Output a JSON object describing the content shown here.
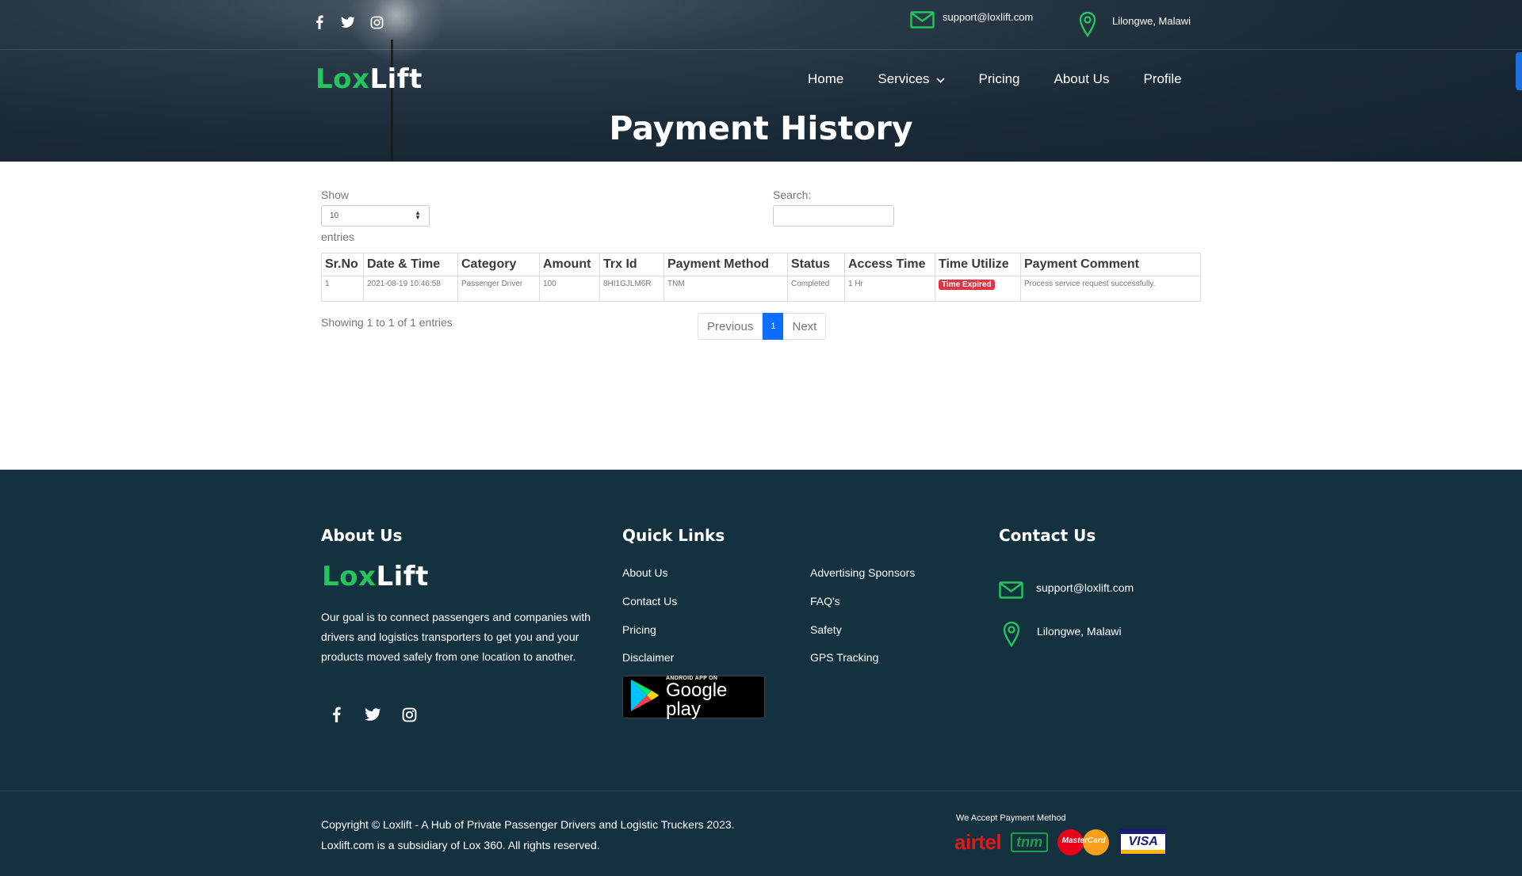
{
  "header": {
    "email": "support@loxlift.com",
    "location": "Lilongwe, Malawi",
    "logo": {
      "part1": "Lox",
      "part2": "Lift"
    },
    "nav": [
      {
        "label": "Home"
      },
      {
        "label": "Services",
        "dropdown": true
      },
      {
        "label": "Pricing"
      },
      {
        "label": "About Us"
      },
      {
        "label": "Profile"
      }
    ],
    "social_icons": [
      "facebook-icon",
      "twitter-icon",
      "instagram-icon"
    ]
  },
  "page_title": "Payment History",
  "datatable": {
    "show_label": "Show",
    "entries_value": "10",
    "entries_label": "entries",
    "search_label": "Search:",
    "search_value": "",
    "columns": [
      "Sr.No",
      "Date & Time",
      "Category",
      "Amount",
      "Trx Id",
      "Payment Method",
      "Status",
      "Access Time",
      "Time Utilize",
      "Payment Comment"
    ],
    "rows": [
      {
        "sr_no": "1",
        "date_time": "2021-08-19 10:46:58",
        "category": "Passenger Driver",
        "amount": "100",
        "trx_id": "8HI1GJLM6R",
        "payment_method": "TNM",
        "status": "Completed",
        "access_time": "1 Hr",
        "time_utilize": "Time Expired",
        "payment_comment": "Process service request successfully."
      }
    ],
    "showing_text": "Showing 1 to 1 of 1 entries",
    "pagination": {
      "previous": "Previous",
      "current": "1",
      "next": "Next"
    }
  },
  "footer": {
    "about_heading": "About Us",
    "logo": {
      "part1": "Lox",
      "part2": "Lift"
    },
    "about_text": "Our goal is to connect passengers and companies with drivers and logistics transporters to get you and your products moved safely from one location to another.",
    "quick_links_heading": "Quick Links",
    "quick_links_col1": [
      "About Us",
      "Contact Us",
      "Pricing",
      "Disclaimer"
    ],
    "quick_links_col2": [
      "Advertising Sponsors",
      "FAQ's",
      "Safety",
      "GPS Tracking"
    ],
    "google_play": {
      "small": "ANDROID APP ON",
      "big": "Google play"
    },
    "contact_heading": "Contact Us",
    "email": "support@loxlift.com",
    "location": "Lilongwe, Malawi",
    "copyright_line1": "Copyright © Loxlift - A Hub of Private Passenger Drivers and Logistic Truckers 2023.",
    "copyright_line2": "Loxlift.com is a subsidiary of Lox 360. All rights reserved.",
    "payment_label": "We Accept Payment Method",
    "payment_methods": [
      "airtel",
      "tnm",
      "MasterCard",
      "VISA"
    ]
  },
  "colors": {
    "brand_green": "#22c55e",
    "header_bg": "#1b2a37",
    "footer_bg": "#13313f",
    "badge_danger": "#dc3545",
    "pagination_active": "#0d6efd"
  }
}
